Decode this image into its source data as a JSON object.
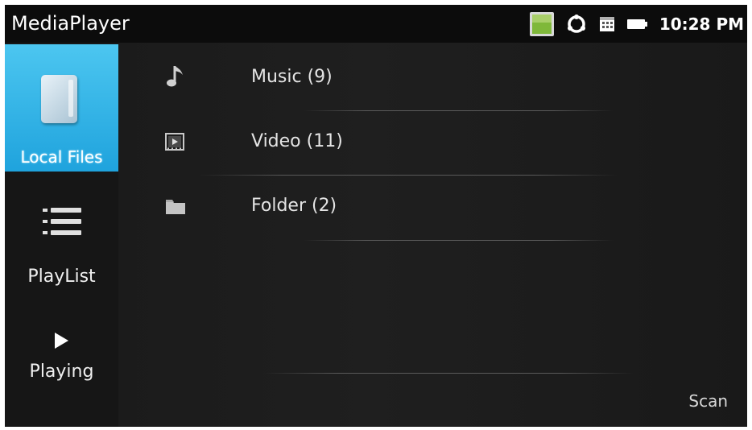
{
  "app": {
    "title": "MediaPlayer"
  },
  "status_bar": {
    "time": "10:28 PM",
    "icons": [
      "gallery-icon",
      "sync-icon",
      "calendar-icon",
      "battery-icon"
    ]
  },
  "sidebar": {
    "items": [
      {
        "label": "Local Files",
        "icon": "document-icon",
        "selected": true
      },
      {
        "label": "PlayList",
        "icon": "list-icon",
        "selected": false
      },
      {
        "label": "Playing",
        "icon": "play-icon",
        "selected": false
      }
    ]
  },
  "library": {
    "rows": [
      {
        "label": "Music (9)",
        "icon": "music-note-icon"
      },
      {
        "label": "Video (11)",
        "icon": "video-icon"
      },
      {
        "label": "Folder (2)",
        "icon": "folder-icon"
      }
    ]
  },
  "actions": {
    "scan_label": "Scan"
  },
  "colors": {
    "accent": "#29b0e6",
    "background": "#1a1a1a",
    "text": "#e4e4e4"
  }
}
